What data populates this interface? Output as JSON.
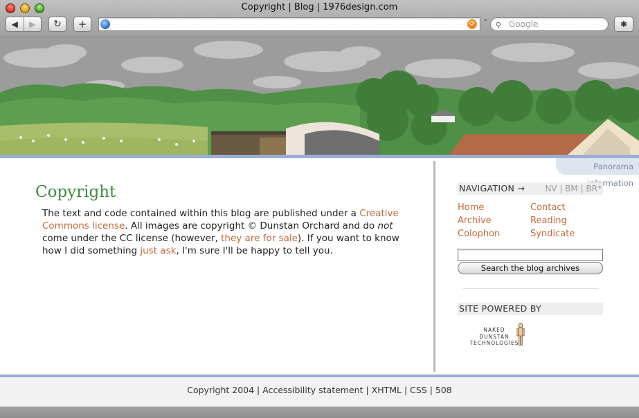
{
  "window": {
    "title": "Copyright | Blog | 1976design.com"
  },
  "toolbar": {
    "back_icon": "◀",
    "forward_icon": "▶",
    "reload_icon": "↻",
    "addtab_icon": "+",
    "debug_icon": "✱",
    "url": "",
    "search_placeholder": "Google",
    "search_icon": "⚲",
    "rss_icon": "⟳",
    "url_arrow": "⌃"
  },
  "sidebar": {
    "panorama_info": "Panorama information",
    "navigation_heading": "NAVIGATION →",
    "navigation_codes": "NV | BM | BR*",
    "nav_links": [
      "Home",
      "Contact",
      "Archive",
      "Reading",
      "Colophon",
      "Syndicate"
    ],
    "search_value": "",
    "search_button": "Search the blog archives",
    "powered_heading": "SITE POWERED BY",
    "powered_logo": {
      "line1": "NAKED",
      "line2": "DUNSTAN",
      "line3": "TECHNOLOGIES"
    }
  },
  "main": {
    "title": "Copyright",
    "para": {
      "t1": "The text and code contained within this blog are published under a ",
      "link1": "Creative Commons license",
      "t2": ". All images are copyright © Dunstan Orchard and do ",
      "em": "not",
      "t3": " come under the CC license (however, ",
      "link2": "they are for sale",
      "t4": "). If you want to know how I did something ",
      "link3": "just ask",
      "t5": ", I'm sure I'll be happy to tell you."
    }
  },
  "footer": {
    "text": "Copyright 2004 | Accessibility statement | XHTML | CSS | 508"
  },
  "colors": {
    "link": "#c06a3c",
    "title": "#3d8b3d",
    "accent_strip": "#9aaed4"
  }
}
